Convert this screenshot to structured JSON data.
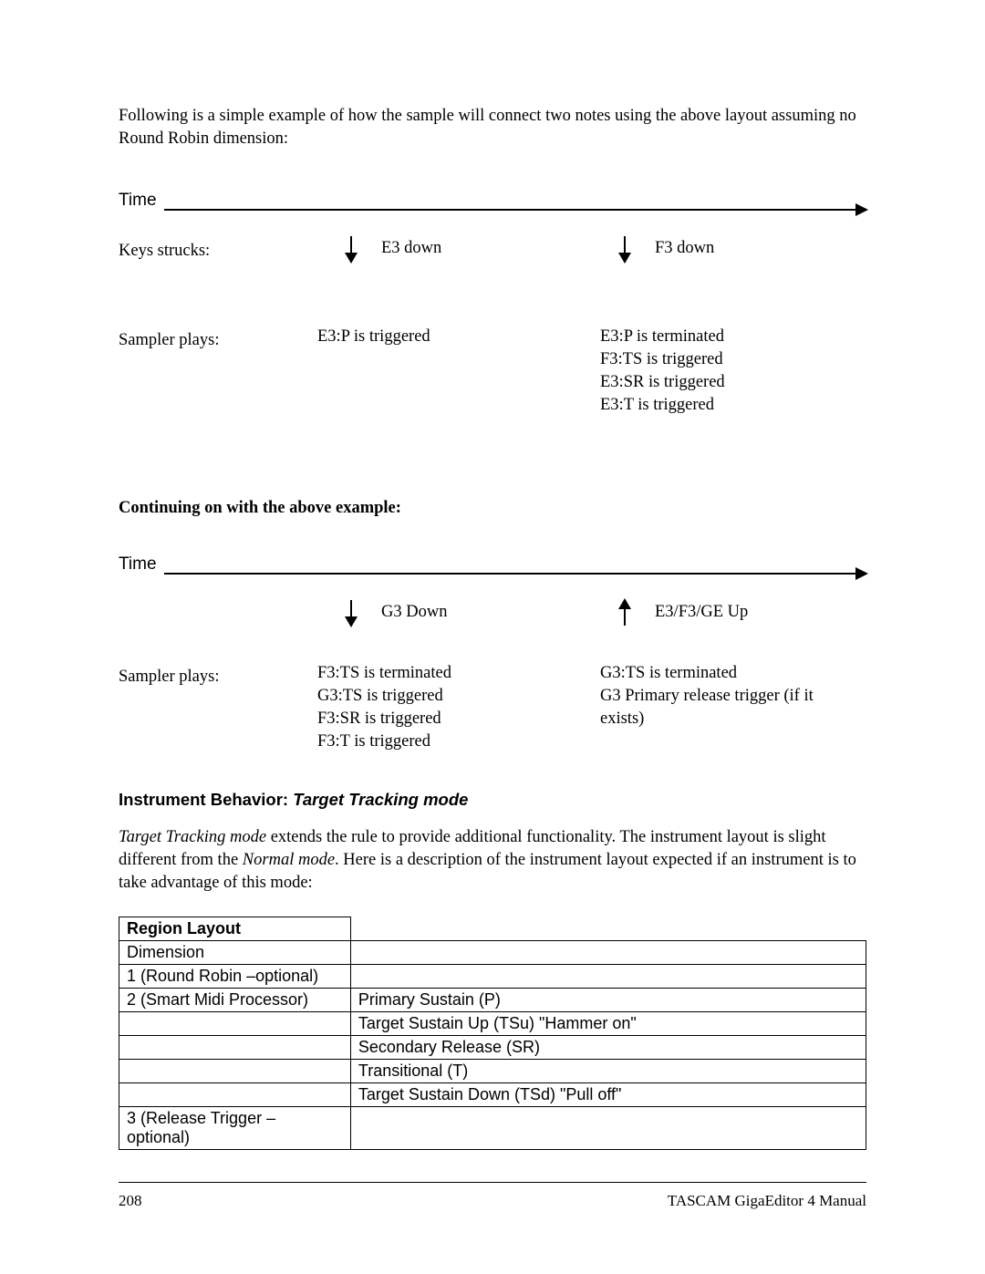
{
  "intro": "Following is a simple example of how the sample will connect two notes using the above layout assuming no Round Robin dimension:",
  "diagram1": {
    "time_label": "Time",
    "keys_label": "Keys strucks:",
    "sampler_label": "Sampler plays:",
    "col1": {
      "key_text": "E3 down",
      "lines": [
        "E3:P is triggered"
      ]
    },
    "col2": {
      "key_text": "F3 down",
      "lines": [
        "E3:P is terminated",
        "F3:TS is triggered",
        "E3:SR is triggered",
        "E3:T is triggered"
      ]
    }
  },
  "continuing": "Continuing on with the above example:",
  "diagram2": {
    "time_label": "Time",
    "sampler_label": "Sampler plays:",
    "col1": {
      "key_text": "G3 Down",
      "lines": [
        "F3:TS is terminated",
        "G3:TS is triggered",
        "F3:SR is triggered",
        "F3:T is triggered"
      ]
    },
    "col2": {
      "key_text": "E3/F3/GE Up",
      "lines": [
        "G3:TS is terminated",
        "G3 Primary release trigger (if it exists)"
      ]
    }
  },
  "section": {
    "prefix": "Instrument Behavior: ",
    "mode": "Target Tracking mode"
  },
  "body_para_pre": "Target Tracking mode",
  "body_para_mid": "  extends the rule to provide additional functionality. The instrument layout is slight different from the ",
  "body_para_normal": "Normal mode",
  "body_para_post": ". Here is a description of the instrument layout expected if an instrument is to take advantage of this mode:",
  "table": {
    "header": "Region Layout",
    "rows": [
      {
        "left": "Dimension",
        "right": ""
      },
      {
        "left": "1 (Round Robin –optional)",
        "right": ""
      },
      {
        "left": "2 (Smart Midi Processor)",
        "right": "Primary Sustain (P)"
      },
      {
        "left": "",
        "right": "Target Sustain Up (TSu) \"Hammer on\""
      },
      {
        "left": "",
        "right": "Secondary Release (SR)"
      },
      {
        "left": "",
        "right": "Transitional (T)"
      },
      {
        "left": "",
        "right": "Target Sustain Down (TSd) \"Pull off\""
      },
      {
        "left": "3 (Release Trigger – optional)",
        "right": ""
      }
    ]
  },
  "footer": {
    "page": "208",
    "title": "TASCAM GigaEditor 4 Manual"
  }
}
